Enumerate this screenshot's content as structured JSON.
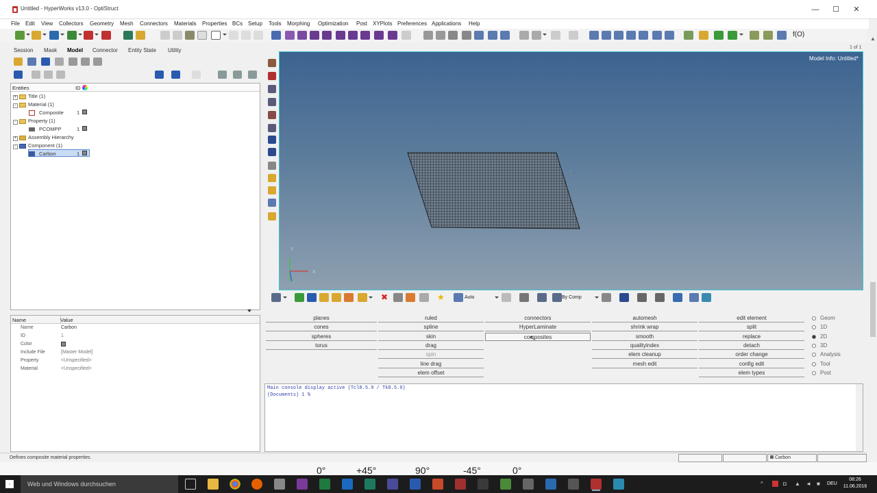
{
  "window": {
    "title": "Untitled - HyperWorks v13.0 - OptiStruct",
    "minimize": "—",
    "maximize": "☐",
    "close": "✕"
  },
  "menu": [
    "File",
    "Edit",
    "View",
    "Collectors",
    "Geometry",
    "Mesh",
    "Connectors",
    "Materials",
    "Properties",
    "BCs",
    "Setup",
    "Tools",
    "Morphing",
    "Optimization",
    "Post",
    "XYPlots",
    "Preferences",
    "Applications",
    "Help"
  ],
  "toolbar": {
    "fo_label": "f(O)"
  },
  "left_tabs": [
    "Session",
    "Mask",
    "Model",
    "Connector",
    "Entity State",
    "Utility"
  ],
  "left_tab_selected": "Model",
  "tree": {
    "header": {
      "entities": "Entities",
      "id": "ID"
    },
    "rows": [
      {
        "label": "Title (1)",
        "id": ""
      },
      {
        "label": "Material (1)",
        "id": ""
      },
      {
        "label": "Composite",
        "id": "1"
      },
      {
        "label": "Property (1)",
        "id": ""
      },
      {
        "label": "PCOMPP",
        "id": "1"
      },
      {
        "label": "Assembly Hierarchy",
        "id": ""
      },
      {
        "label": "Component (1)",
        "id": ""
      },
      {
        "label": "Carbon",
        "id": "1"
      }
    ]
  },
  "props": {
    "header": {
      "name": "Name",
      "value": "Value"
    },
    "rows": [
      {
        "name": "Name",
        "value": "Carbon"
      },
      {
        "name": "ID",
        "value": "1"
      },
      {
        "name": "Color",
        "value": ""
      },
      {
        "name": "Include File",
        "value": "[Master Model]"
      },
      {
        "name": "Property",
        "value": "<Unspecified>"
      },
      {
        "name": "Material",
        "value": "<Unspecified>"
      }
    ]
  },
  "viewport": {
    "model_info": "Model Info: Untitled*",
    "page": "1 of 1",
    "axis_y": "Y",
    "axis_x": "X",
    "mesh_color": "#1e1e1e",
    "bg_top": "#3c6390",
    "bg_bottom": "#8ea0b0"
  },
  "vtoolbar": {
    "auto": "Auto",
    "by_comp": "By Comp"
  },
  "panels": {
    "col1": [
      "planes",
      "cones",
      "spheres",
      "torus"
    ],
    "col2": [
      "ruled",
      "spline",
      "skin",
      "drag",
      "spin",
      "line drag",
      "elem offset"
    ],
    "col3": [
      "connectors",
      "HyperLaminate",
      "composites"
    ],
    "col4": [
      "automesh",
      "shrink wrap",
      "smooth",
      "qualityindex",
      "elem cleanup",
      "mesh edit"
    ],
    "col5": [
      "edit element",
      "split",
      "replace",
      "detach",
      "order change",
      "config edit",
      "elem types"
    ],
    "radios": [
      "Geom",
      "1D",
      "2D",
      "3D",
      "Analysis",
      "Tool",
      "Post"
    ],
    "radio_selected": "2D",
    "selected_panel": "composites"
  },
  "console": {
    "line1": "Main console display active (Tcl8.5.9 / Tk8.5.9)",
    "line2": "(Documents) 1 %"
  },
  "status": {
    "text": "Defines composite material properties.",
    "component": "Carbon"
  },
  "background_strip": [
    "0°",
    "+45°",
    "90°",
    "-45°",
    "0°"
  ],
  "taskbar": {
    "search": "Web und Windows durchsuchen",
    "time": "08:26",
    "date": "11.06.2016",
    "lang": "DEU"
  }
}
